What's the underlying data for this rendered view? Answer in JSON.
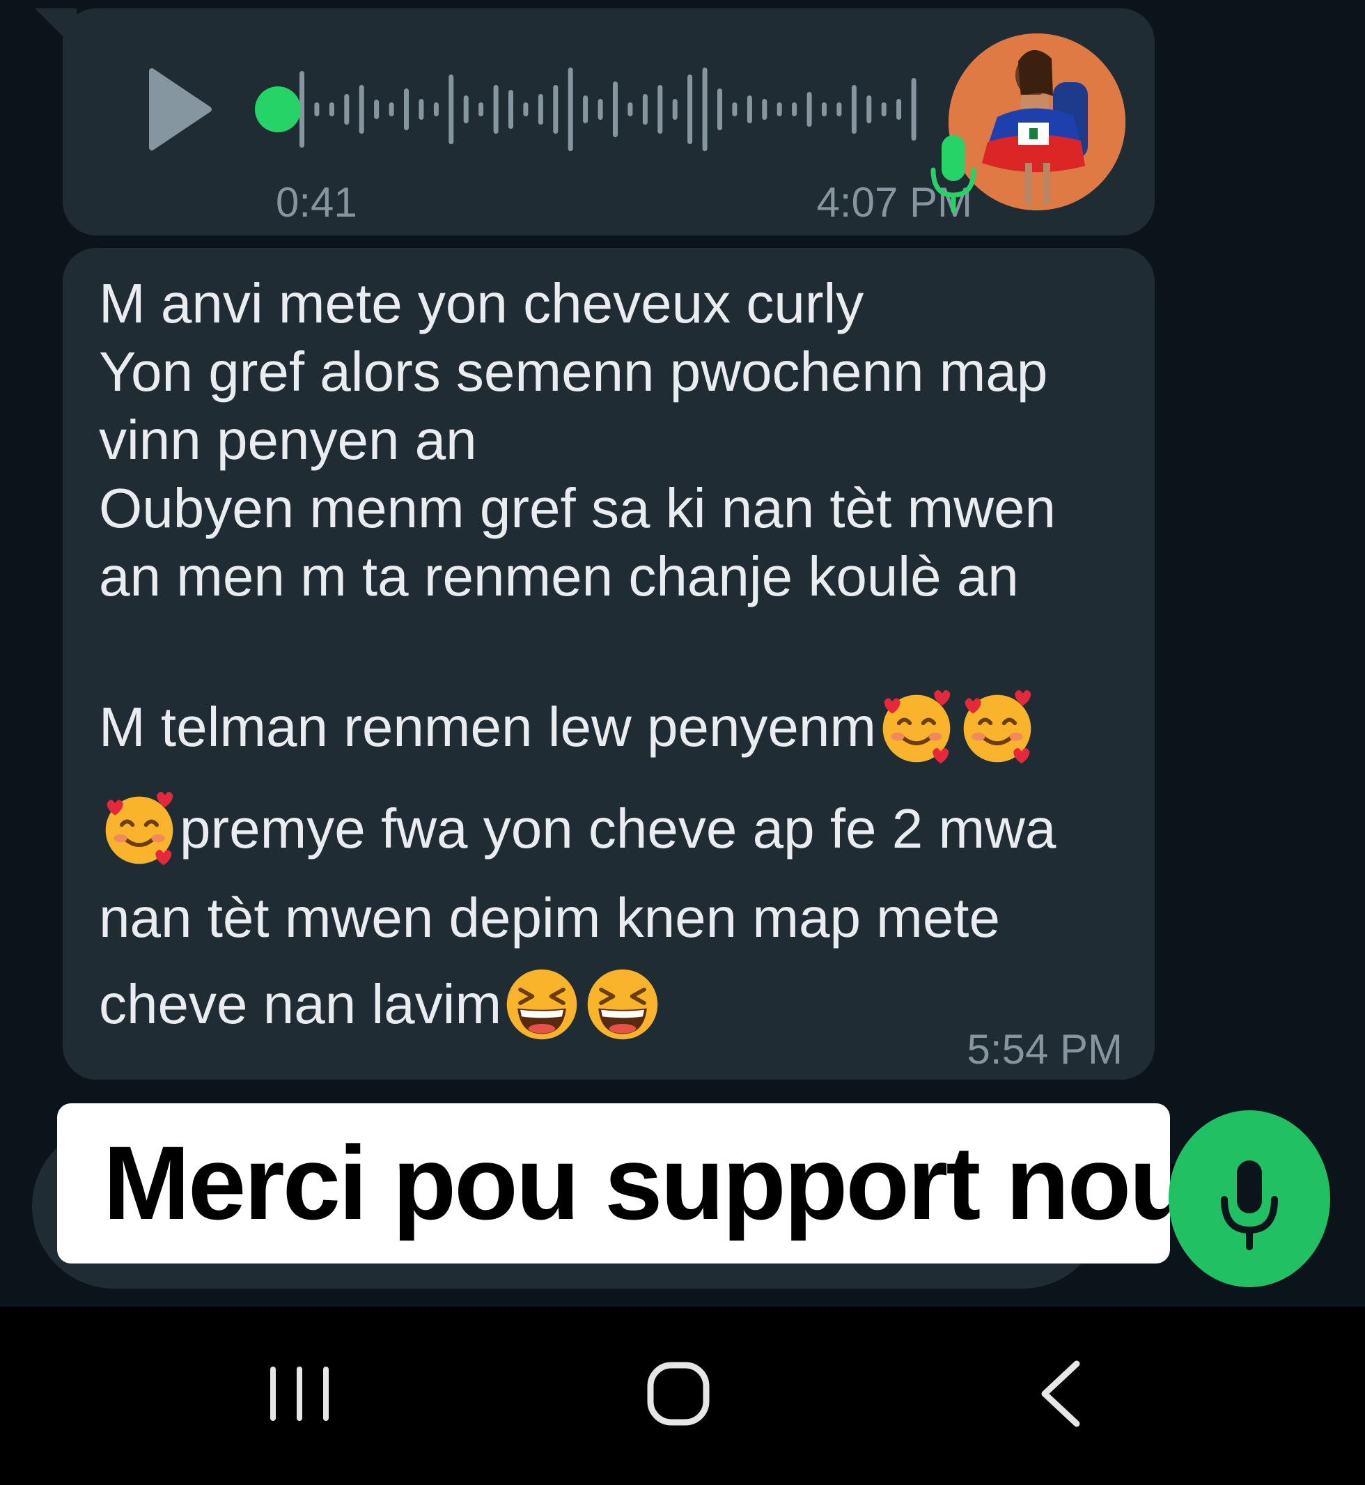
{
  "voice_message": {
    "duration": "0:41",
    "time": "4:07 PM",
    "icons": {
      "play": "play-icon",
      "progress": "progress-dot",
      "mic": "microphone-icon"
    },
    "colors": {
      "progress": "#25d366",
      "bubble": "#202c33"
    }
  },
  "text_message": {
    "lines": [
      "M anvi mete yon cheveux curly",
      "Yon gref alors semenn pwochenn map",
      "vinn penyen an",
      "Oubyen menm gref sa ki nan tèt mwen",
      "an men m ta renmen chanje koulè an"
    ],
    "line_with_emoji_1": "M telman renmen lew penyenm",
    "line_with_emoji_2": "premye fwa yon cheve ap fe 2 mwa",
    "line_7": "nan tèt mwen depim knen map mete",
    "line_with_emoji_3": "cheve nan lavim",
    "emojis": [
      "smiling-face-with-hearts",
      "smiling-face-with-hearts",
      "smiling-face-with-hearts",
      "grinning-squinting-face",
      "grinning-squinting-face"
    ],
    "time": "5:54 PM"
  },
  "caption": {
    "text": "Merci pou support nou"
  },
  "input": {
    "mic_icon": "microphone-icon",
    "mic_color": "#21c063"
  },
  "nav_bar": {
    "recents_icon": "recents-icon",
    "home_icon": "home-icon",
    "back_icon": "back-icon"
  }
}
